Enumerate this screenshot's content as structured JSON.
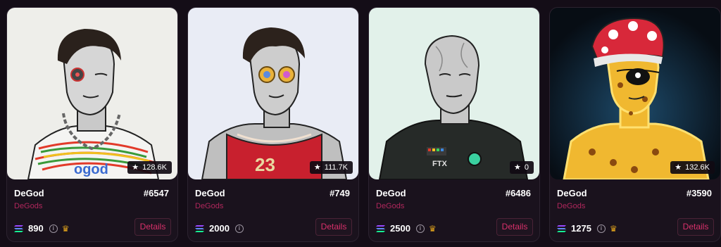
{
  "cards": [
    {
      "title": "DeGod",
      "number": "#6547",
      "collection": "DeGods",
      "likes": "128.6K",
      "price": "890",
      "crown": true,
      "details_label": "Details",
      "bg_color": "#eeeeea"
    },
    {
      "title": "DeGod",
      "number": "#749",
      "collection": "DeGods",
      "likes": "111.7K",
      "price": "2000",
      "crown": false,
      "details_label": "Details",
      "bg_color": "#e9ecf5"
    },
    {
      "title": "DeGod",
      "number": "#6486",
      "collection": "DeGods",
      "likes": "0",
      "price": "2500",
      "crown": true,
      "details_label": "Details",
      "bg_color": "#e2f1ea"
    },
    {
      "title": "DeGod",
      "number": "#3590",
      "collection": "DeGods",
      "likes": "132.6K",
      "price": "1275",
      "crown": true,
      "details_label": "Details",
      "bg_color": "#0e2030"
    }
  ],
  "icons": {
    "like": "star-icon",
    "currency": "solana-icon",
    "info": "info-icon",
    "crown": "crown-icon"
  },
  "colors": {
    "page_bg": "#140d17",
    "accent": "#d8306a",
    "collection_text": "#b0275c",
    "crown": "#e0a21c"
  }
}
